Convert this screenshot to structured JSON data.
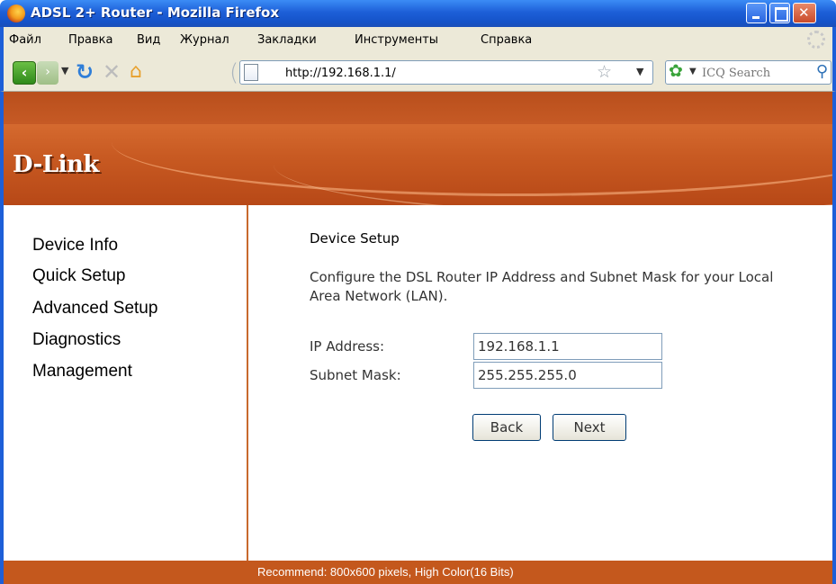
{
  "window": {
    "title": "ADSL 2+ Router - Mozilla Firefox"
  },
  "menu": {
    "items": [
      "Файл",
      "Правка",
      "Вид",
      "Журнал",
      "Закладки",
      "Инструменты",
      "Справка"
    ]
  },
  "toolbar": {
    "url": "http://192.168.1.1/",
    "search_placeholder": "ICQ Search",
    "icons": [
      "back-icon",
      "forward-icon",
      "reload-icon",
      "stop-icon",
      "home-icon",
      "page-icon",
      "bookmark-star-icon",
      "search-engine-icon",
      "search-magnifier-icon"
    ]
  },
  "brand": {
    "logo": "D-Link",
    "accent_color": "#c85a22"
  },
  "sidebar": {
    "items": [
      "Device Info",
      "Quick Setup",
      "Advanced Setup",
      "Diagnostics",
      "Management"
    ]
  },
  "content": {
    "heading": "Device Setup",
    "description": "Configure the DSL Router IP Address and Subnet Mask for your Local Area Network (LAN).",
    "fields": [
      {
        "label": "IP Address:",
        "value": "192.168.1.1"
      },
      {
        "label": "Subnet Mask:",
        "value": "255.255.255.0"
      }
    ],
    "buttons": {
      "back": "Back",
      "next": "Next"
    }
  },
  "footer": {
    "text": "Recommend: 800x600 pixels, High Color(16 Bits)"
  }
}
